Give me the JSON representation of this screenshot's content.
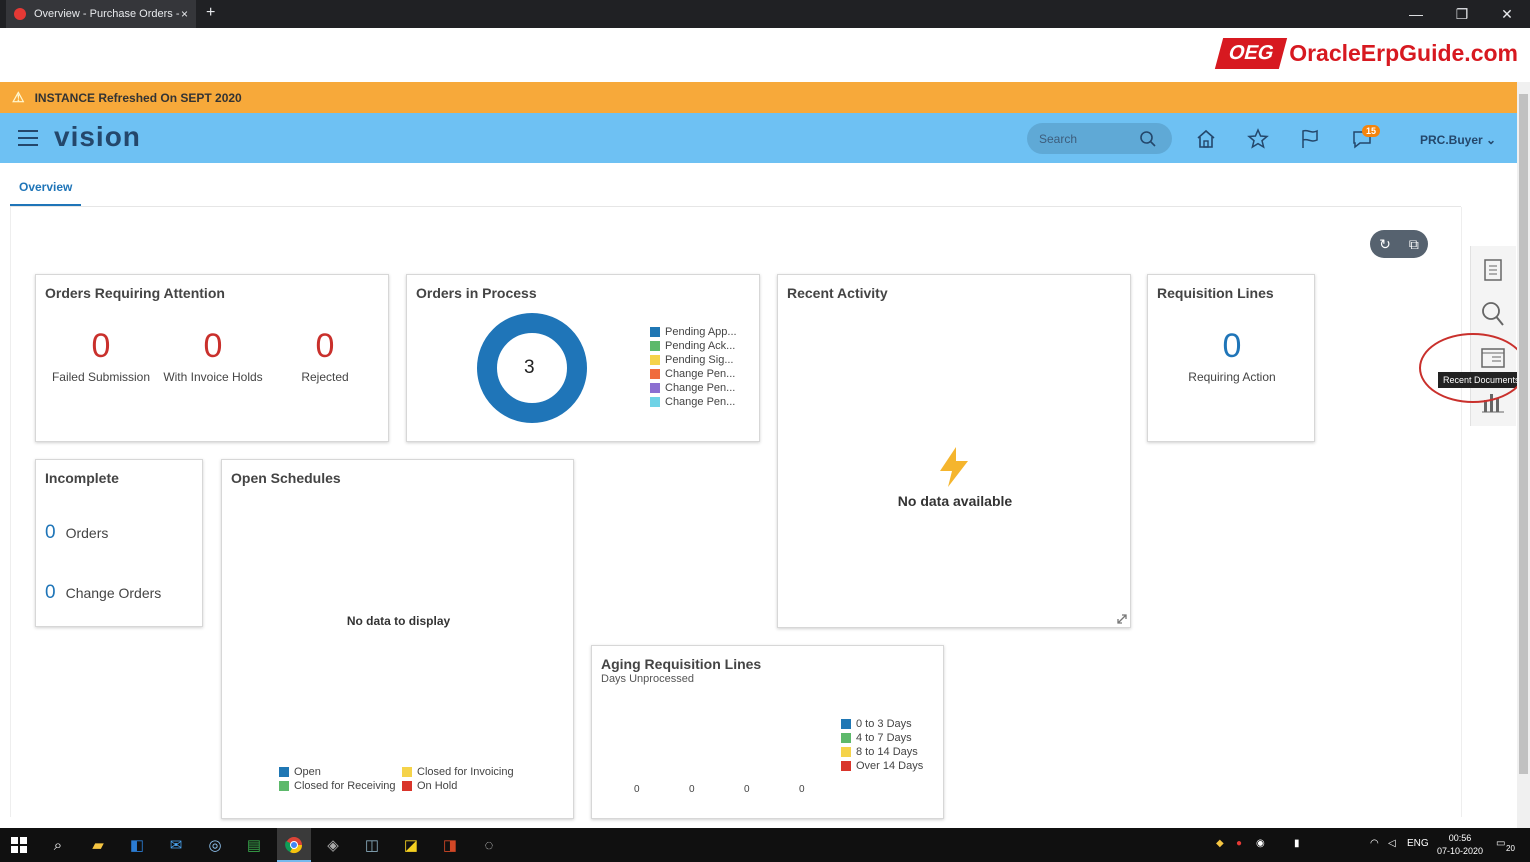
{
  "browser": {
    "tab_title": "Overview - Purchase Orders - Or",
    "tab_close": "×",
    "new_tab": "+",
    "minimize": "—",
    "restore": "❐",
    "close": "✕"
  },
  "watermark": {
    "badge": "OEG",
    "site": "OracleErpGuide.com"
  },
  "banner": {
    "text": "INSTANCE Refreshed On SEPT 2020"
  },
  "header": {
    "brand": "vision",
    "search_placeholder": "Search",
    "notification_count": "15",
    "user": "PRC.Buyer"
  },
  "tabs": [
    {
      "label": "Overview"
    }
  ],
  "cards": {
    "orders_requiring_attention": {
      "title": "Orders Requiring Attention",
      "metrics": [
        {
          "value": "0",
          "label": "Failed Submission"
        },
        {
          "value": "0",
          "label": "With Invoice Holds"
        },
        {
          "value": "0",
          "label": "Rejected"
        }
      ]
    },
    "orders_in_process": {
      "title": "Orders in Process",
      "total": "3",
      "legend": [
        {
          "label": "Pending App...",
          "color": "#1f77b4"
        },
        {
          "label": "Pending Ack...",
          "color": "#5db96b"
        },
        {
          "label": "Pending Sig...",
          "color": "#f5d34a"
        },
        {
          "label": "Change Pen...",
          "color": "#f06c3e"
        },
        {
          "label": "Change Pen...",
          "color": "#8c6fd1"
        },
        {
          "label": "Change Pen...",
          "color": "#6fd3e6"
        }
      ]
    },
    "recent_activity": {
      "title": "Recent Activity",
      "empty": "No data available"
    },
    "requisition_lines": {
      "title": "Requisition Lines",
      "value": "0",
      "label": "Requiring Action"
    },
    "incomplete": {
      "title": "Incomplete",
      "rows": [
        {
          "value": "0",
          "label": "Orders"
        },
        {
          "value": "0",
          "label": "Change Orders"
        }
      ]
    },
    "open_schedules": {
      "title": "Open Schedules",
      "empty": "No data to display",
      "legend": [
        {
          "label": "Open",
          "color": "#1f77b4"
        },
        {
          "label": "Closed for Invoicing",
          "color": "#f5d34a"
        },
        {
          "label": "Closed for Receiving",
          "color": "#5db96b"
        },
        {
          "label": "On Hold",
          "color": "#d9352b"
        }
      ]
    },
    "aging_requisition_lines": {
      "title": "Aging Requisition Lines",
      "subtitle": "Days Unprocessed",
      "legend": [
        {
          "label": "0 to 3 Days",
          "color": "#1f77b4"
        },
        {
          "label": "4 to 7 Days",
          "color": "#5db96b"
        },
        {
          "label": "8 to 14 Days",
          "color": "#f5d34a"
        },
        {
          "label": "Over 14 Days",
          "color": "#d9352b"
        }
      ],
      "values": [
        "0",
        "0",
        "0",
        "0"
      ]
    }
  },
  "side_panel": {
    "tooltip": "Recent Documents"
  },
  "taskbar": {
    "lang": "ENG",
    "time": "00:56",
    "date": "07-10-2020",
    "notif": "20"
  }
}
